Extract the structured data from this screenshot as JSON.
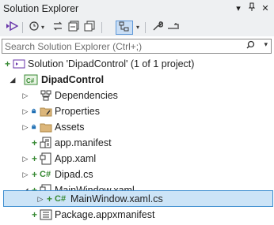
{
  "window": {
    "title": "Solution Explorer",
    "buttons": [
      "▾",
      "📌",
      "✕"
    ]
  },
  "toolbar": {
    "items": [
      "vs-switch-icon",
      "history-icon",
      "sync-icon",
      "collapse-icon",
      "copy-icon",
      "show-all-icon",
      "wrench-icon",
      "preview-icon"
    ]
  },
  "search": {
    "placeholder": "Search Solution Explorer (Ctrl+;)",
    "value": ""
  },
  "tree": [
    {
      "label": "Solution 'DipadControl' (1 of 1 project)",
      "status": "add",
      "icon": "solution-icon",
      "bold": false,
      "expander": ""
    },
    {
      "label": "DipadControl",
      "status": "",
      "icon": "csharp-project-icon",
      "bold": true,
      "expander": "expanded"
    },
    {
      "label": "Dependencies",
      "status": "",
      "icon": "dependencies-icon",
      "bold": false,
      "expander": "collapsed"
    },
    {
      "label": "Properties",
      "status": "lock",
      "icon": "properties-icon",
      "bold": false,
      "expander": "collapsed"
    },
    {
      "label": "Assets",
      "status": "lock",
      "icon": "folder-icon",
      "bold": false,
      "expander": "collapsed"
    },
    {
      "label": "app.manifest",
      "status": "add",
      "icon": "manifest-icon",
      "bold": false,
      "expander": ""
    },
    {
      "label": "App.xaml",
      "status": "add",
      "icon": "xaml-icon",
      "bold": false,
      "expander": "collapsed"
    },
    {
      "label": "Dipad.cs",
      "status": "add",
      "icon": "csharp-file-icon",
      "bold": false,
      "expander": "collapsed"
    },
    {
      "label": "MainWindow.xaml",
      "status": "add",
      "icon": "xaml-icon",
      "bold": false,
      "expander": "expanded"
    },
    {
      "label": "MainWindow.xaml.cs",
      "status": "add",
      "icon": "csharp-file-icon",
      "bold": false,
      "expander": "collapsed",
      "selected": true
    },
    {
      "label": "Package.appxmanifest",
      "status": "add",
      "icon": "package-manifest-icon",
      "bold": false,
      "expander": ""
    }
  ]
}
